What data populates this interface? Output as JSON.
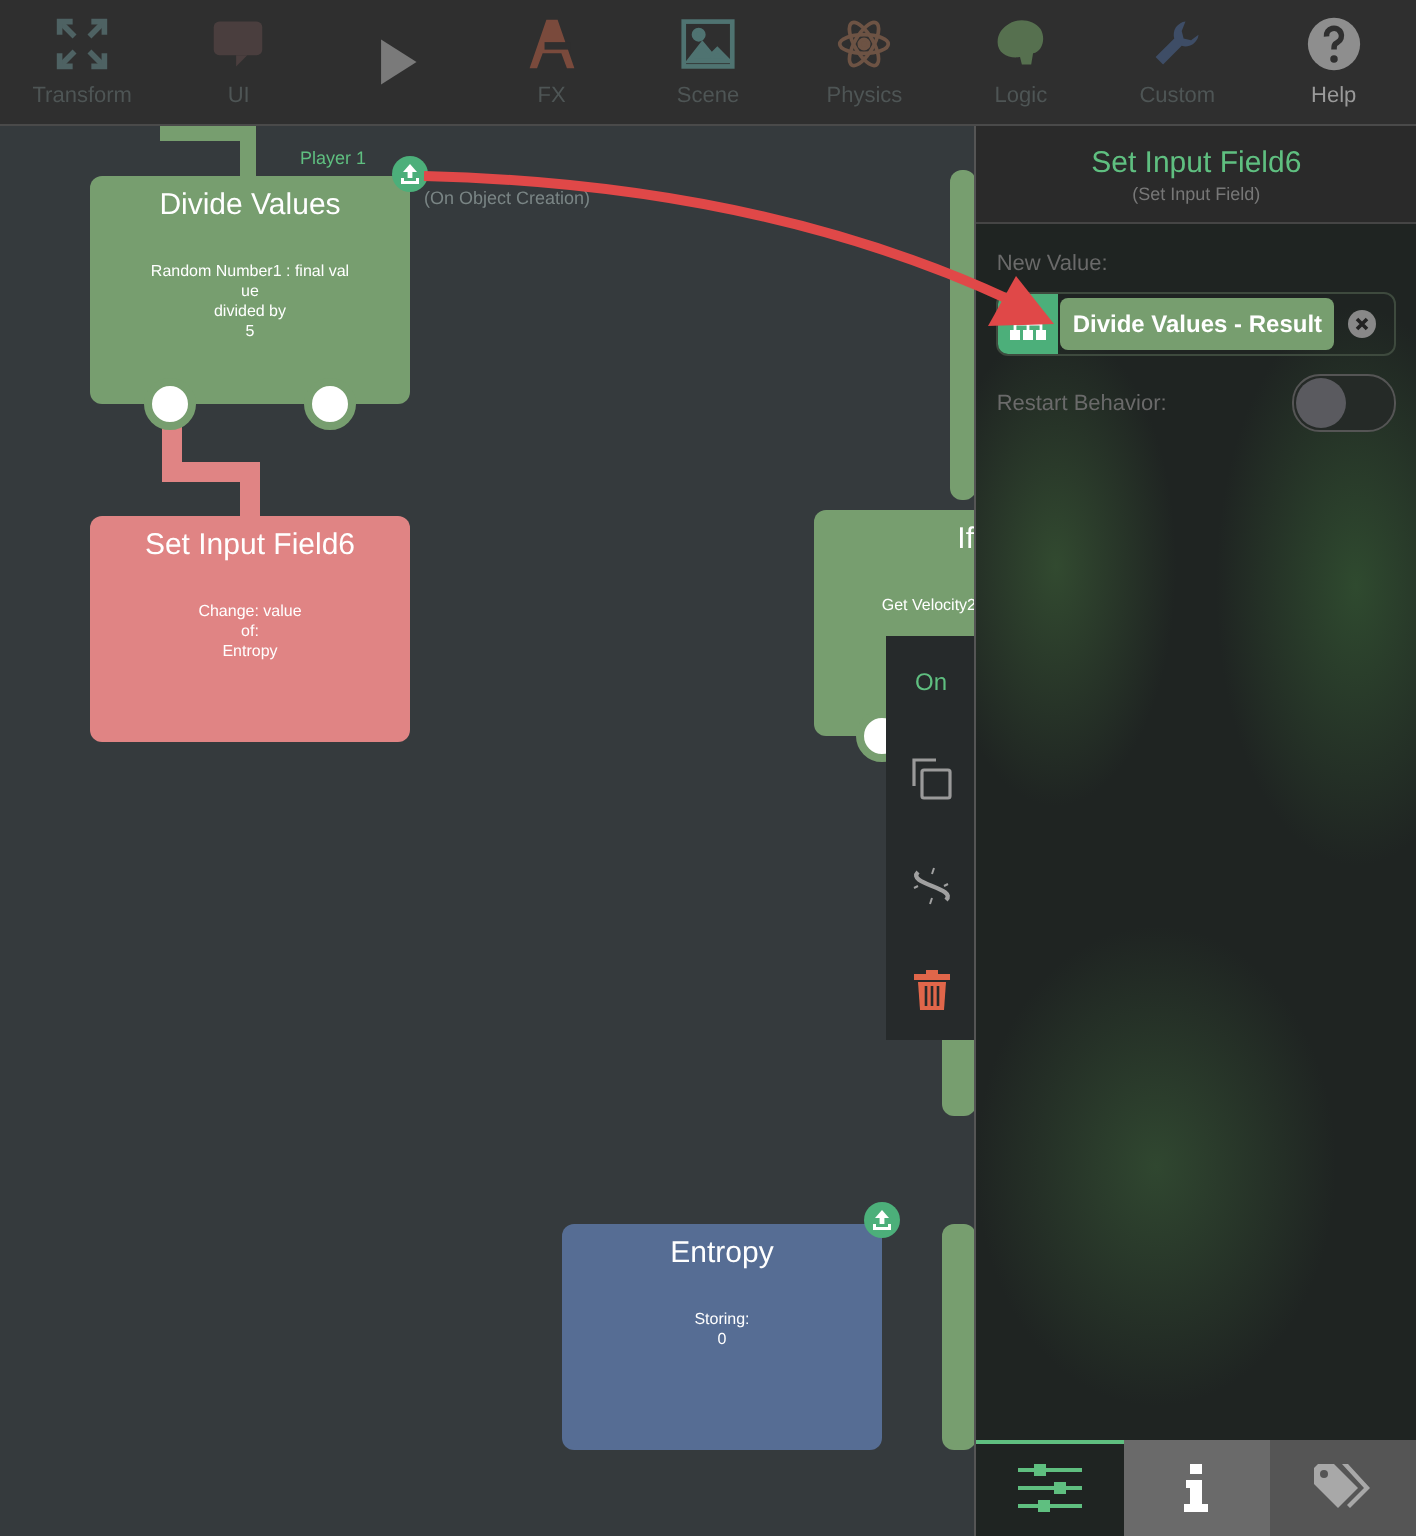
{
  "toolbar": [
    {
      "kind": "transform",
      "label": "Transform",
      "color": "#4e6263"
    },
    {
      "kind": "ui",
      "label": "UI",
      "color": "#4a3e3e"
    },
    {
      "kind": "play",
      "color": "#7a7a7a"
    },
    {
      "kind": "fx",
      "label": "FX",
      "color": "#7a4a3c"
    },
    {
      "kind": "scene",
      "label": "Scene",
      "color": "#4f7371"
    },
    {
      "kind": "physics",
      "label": "Physics",
      "color": "#6d5344"
    },
    {
      "kind": "logic",
      "label": "Logic",
      "color": "#56704f"
    },
    {
      "kind": "custom",
      "label": "Custom",
      "color": "#3e4d66"
    },
    {
      "kind": "help",
      "label": "Help",
      "color": "#8e8e8e"
    }
  ],
  "canvas": {
    "object_label": {
      "name": "Player 1",
      "event": "(On Object Creation)"
    },
    "nodes": [
      {
        "kind": "divide",
        "title": "Divide Values",
        "lines": [
          "Random Number1 : final val",
          "ue",
          "divided by",
          "5"
        ],
        "color": "#779e6f"
      },
      {
        "kind": "set",
        "title": "Set Input Field6",
        "lines": [
          "Change: value",
          "of:",
          "Entropy"
        ],
        "color": "#e08484"
      },
      {
        "kind": "if",
        "title": "If",
        "lines": [
          "Get Velocity2"
        ],
        "color": "#779e6f"
      },
      {
        "kind": "entropy",
        "title": "Entropy",
        "lines": [
          "Storing:",
          "0"
        ],
        "color": "#566d94"
      }
    ],
    "context_menu": [
      {
        "kind": "toggle",
        "label": "On"
      },
      {
        "kind": "copy"
      },
      {
        "kind": "unlink"
      },
      {
        "kind": "delete"
      }
    ]
  },
  "panel": {
    "title": "Set Input Field6",
    "subtitle": "(Set Input Field)",
    "new_value_label": "New Value:",
    "new_value": "Divide Values - Result",
    "restart_label": "Restart Behavior:",
    "restart_on": false,
    "tabs": [
      {
        "kind": "settings",
        "selected": true
      },
      {
        "kind": "info",
        "selected": false
      },
      {
        "kind": "tags",
        "selected": false
      }
    ]
  }
}
